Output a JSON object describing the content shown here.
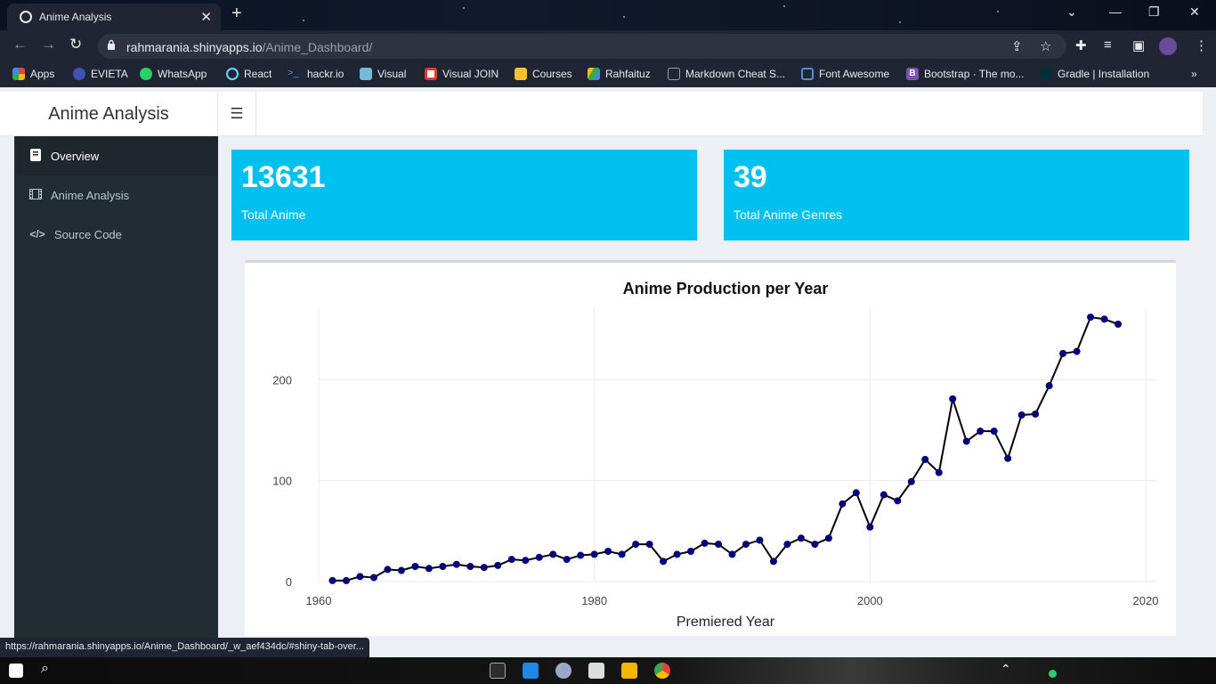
{
  "browser": {
    "tab_title": "Anime Analysis",
    "url_host": "rahmarania.shinyapps.io",
    "url_path": "/Anime_Dashboard/",
    "status_url": "https://rahmarania.shinyapps.io/Anime_Dashboard/_w_aef434dc/#shiny-tab-over...",
    "bookmarks": [
      {
        "label": "Apps",
        "color": "#ea4335"
      },
      {
        "label": "EVIETA",
        "color": "#3f51b5"
      },
      {
        "label": "WhatsApp",
        "color": "#25d366"
      },
      {
        "label": "React",
        "color": "#61dafb"
      },
      {
        "label": "hackr.io",
        "color": "#4a90e2"
      },
      {
        "label": "Visual",
        "color": "#7ab8d9"
      },
      {
        "label": "Visual JOIN",
        "color": "#e53935"
      },
      {
        "label": "Courses",
        "color": "#fbc02d"
      },
      {
        "label": "Rahfaituz",
        "color": "#34a853"
      },
      {
        "label": "Markdown Cheat S...",
        "color": "#9e9e9e"
      },
      {
        "label": "Font Awesome",
        "color": "#538dd7"
      },
      {
        "label": "Bootstrap · The mo...",
        "color": "#7952b3"
      },
      {
        "label": "Gradle | Installation",
        "color": "#02303a"
      }
    ]
  },
  "app": {
    "brand": "Anime Analysis",
    "sidebar": [
      {
        "label": "Overview",
        "icon": "book-icon"
      },
      {
        "label": "Anime Analysis",
        "icon": "film-icon"
      },
      {
        "label": "Source Code",
        "icon": "code-icon"
      }
    ],
    "value_boxes": [
      {
        "value": "13631",
        "label": "Total Anime"
      },
      {
        "value": "39",
        "label": "Total Anime Genres"
      }
    ]
  },
  "chart_data": {
    "type": "line",
    "title": "Anime Production per Year",
    "xlabel": "Premiered Year",
    "ylabel": "",
    "xlim": [
      1960,
      2020
    ],
    "ylim": [
      0,
      270
    ],
    "xticks": [
      1960,
      1980,
      2000,
      2020
    ],
    "yticks": [
      0,
      100,
      200
    ],
    "grid": true,
    "line_color": "#000000",
    "marker_color": "#00007a",
    "x": [
      1961,
      1962,
      1963,
      1964,
      1965,
      1966,
      1967,
      1968,
      1969,
      1970,
      1971,
      1972,
      1973,
      1974,
      1975,
      1976,
      1977,
      1978,
      1979,
      1980,
      1981,
      1982,
      1983,
      1984,
      1985,
      1986,
      1987,
      1988,
      1989,
      1990,
      1991,
      1992,
      1993,
      1994,
      1995,
      1996,
      1997,
      1998,
      1999,
      2000,
      2001,
      2002,
      2003,
      2004,
      2005,
      2006,
      2007,
      2008,
      2009,
      2010,
      2011,
      2012,
      2013,
      2014,
      2015,
      2016,
      2017,
      2018
    ],
    "y": [
      1,
      1,
      5,
      4,
      12,
      11,
      15,
      13,
      15,
      17,
      15,
      14,
      16,
      22,
      21,
      24,
      27,
      22,
      26,
      27,
      30,
      27,
      37,
      37,
      20,
      27,
      30,
      38,
      37,
      27,
      37,
      41,
      20,
      37,
      43,
      37,
      43,
      77,
      88,
      54,
      86,
      80,
      99,
      121,
      108,
      181,
      139,
      149,
      149,
      122,
      165,
      166,
      194,
      226,
      228,
      262,
      260,
      255
    ]
  }
}
